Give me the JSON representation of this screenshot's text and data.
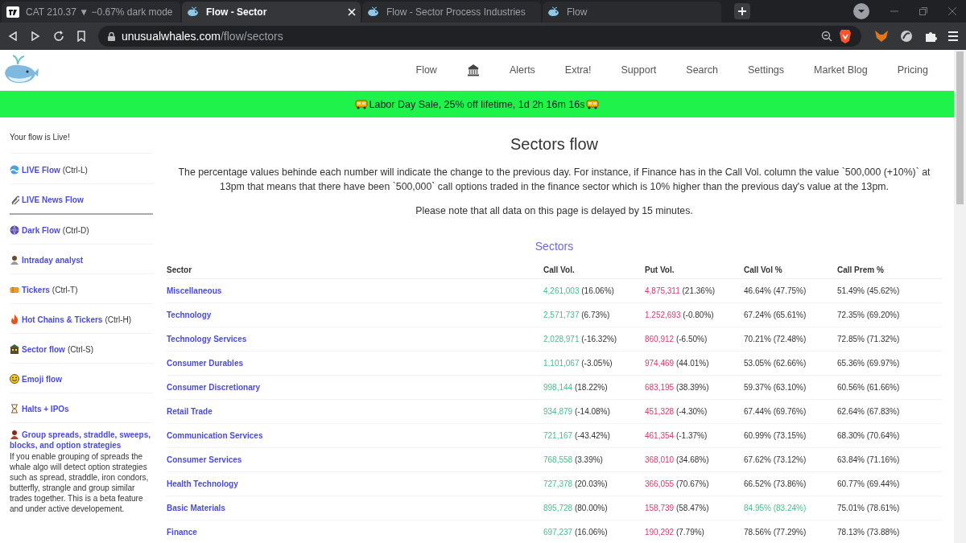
{
  "browser": {
    "tabs": [
      {
        "kind": "chart",
        "title": "CAT 210.37 ▼ −0.67% dark mode",
        "selected": false
      },
      {
        "kind": "site",
        "title": "Flow - Sector",
        "selected": true
      },
      {
        "kind": "site",
        "title": "Flow - Sector Process Industries",
        "selected": false
      },
      {
        "kind": "site",
        "title": "Flow",
        "selected": false
      }
    ],
    "address": {
      "domain": "unusualwhales.com",
      "path": "/flow/sectors"
    }
  },
  "header": {
    "nav": [
      {
        "kind": "link",
        "label": "Flow"
      },
      {
        "kind": "icon"
      },
      {
        "kind": "link",
        "label": "Alerts"
      },
      {
        "kind": "link",
        "label": "Extra!"
      },
      {
        "kind": "link",
        "label": "Support"
      },
      {
        "kind": "link",
        "label": "Search"
      },
      {
        "kind": "link",
        "label": "Settings"
      },
      {
        "kind": "link",
        "label": "Market Blog"
      },
      {
        "kind": "link",
        "label": "Pricing"
      }
    ]
  },
  "banner": {
    "text": "Labor Day Sale, 25% off lifetime, 1d 2h 16m 16s"
  },
  "sidebar": {
    "status": "Your flow is Live!",
    "items": [
      {
        "label": "LIVE Flow",
        "shortcut": "(Ctrl-L)",
        "divider_after": false
      },
      {
        "label": "LIVE News Flow",
        "divider_after": true
      },
      {
        "label": "Dark Flow",
        "shortcut": "(Ctrl-D)",
        "divider_after": false
      },
      {
        "label": "Intraday analyst",
        "divider_after": false
      },
      {
        "label": "Tickers",
        "shortcut": "(Ctrl-T)",
        "divider_after": false
      },
      {
        "label": "Hot Chains & Tickers",
        "shortcut": "(Ctrl-H)",
        "divider_after": false
      },
      {
        "label": "Sector flow",
        "shortcut": "(Ctrl-S)",
        "divider_after": false
      },
      {
        "label": "Emoji flow",
        "divider_after": false
      },
      {
        "label": "Halts + IPOs",
        "divider_after": false
      },
      {
        "label": "Group spreads, straddle, sweeps, blocks, and option strategies",
        "description": "If you enable grouping of spreads the whale algo will detect option strategies such as spread, straddle, iron condors, butterfly, strangle and group similar trades together. This is a beta feature and under active developement.",
        "divider_after": false
      }
    ]
  },
  "main": {
    "title": "Sectors flow",
    "intro": "The percentage values behinde each number will indicate the change to the previous day. For instance, if Finance has in the Call Vol. column the value `500,000 (+10%)` at 13pm that means that there have been `500,000` call options traded in the finance sector which is 10% higher than the previous day's value at the 13pm.",
    "note": "Please note that all data on this page is delayed by 15 minutes.",
    "section_title": "Sectors",
    "table": {
      "columns": [
        "Sector",
        "Call Vol.",
        "Put Vol.",
        "Call Vol %",
        "Call Prem %"
      ],
      "rows": [
        {
          "sector": "Miscellaneous",
          "call_vol": {
            "value": "4,261,003",
            "change": "(16.06%)"
          },
          "put_vol": {
            "value": "4,875,311",
            "change": "(21.36%)"
          },
          "call_vol_pct": "46.64% (47.75%)",
          "highlighted": false,
          "call_prem_pct": "51.49% (45.62%)"
        },
        {
          "sector": "Technology",
          "call_vol": {
            "value": "2,571,737",
            "change": "(6.73%)"
          },
          "put_vol": {
            "value": "1,252,693",
            "change": "(-0.80%)"
          },
          "call_vol_pct": "67.24% (65.61%)",
          "highlighted": false,
          "call_prem_pct": "72.35% (69.20%)"
        },
        {
          "sector": "Technology Services",
          "call_vol": {
            "value": "2,028,971",
            "change": "(-16.32%)"
          },
          "put_vol": {
            "value": "860,912",
            "change": "(-6.50%)"
          },
          "call_vol_pct": "70.21% (72.48%)",
          "highlighted": false,
          "call_prem_pct": "72.85% (71.32%)"
        },
        {
          "sector": "Consumer Durables",
          "call_vol": {
            "value": "1,101,067",
            "change": "(-3.05%)"
          },
          "put_vol": {
            "value": "974,469",
            "change": "(44.01%)"
          },
          "call_vol_pct": "53.05% (62.66%)",
          "highlighted": false,
          "call_prem_pct": "65.36% (69.97%)"
        },
        {
          "sector": "Consumer Discretionary",
          "call_vol": {
            "value": "998,144",
            "change": "(18.22%)"
          },
          "put_vol": {
            "value": "683,195",
            "change": "(38.39%)"
          },
          "call_vol_pct": "59.37% (63.10%)",
          "highlighted": false,
          "call_prem_pct": "60.56% (61.66%)"
        },
        {
          "sector": "Retail Trade",
          "call_vol": {
            "value": "934,879",
            "change": "(-14.08%)"
          },
          "put_vol": {
            "value": "451,328",
            "change": "(-4.30%)"
          },
          "call_vol_pct": "67.44% (69.76%)",
          "highlighted": false,
          "call_prem_pct": "62.64% (67.83%)"
        },
        {
          "sector": "Communication Services",
          "call_vol": {
            "value": "721,167",
            "change": "(-43.42%)"
          },
          "put_vol": {
            "value": "461,354",
            "change": "(-1.37%)"
          },
          "call_vol_pct": "60.99% (73.15%)",
          "highlighted": false,
          "call_prem_pct": "68.30% (70.64%)"
        },
        {
          "sector": "Consumer Services",
          "call_vol": {
            "value": "768,558",
            "change": "(3.39%)"
          },
          "put_vol": {
            "value": "368,010",
            "change": "(34.68%)"
          },
          "call_vol_pct": "67.62% (73.12%)",
          "highlighted": false,
          "call_prem_pct": "63.84% (71.16%)"
        },
        {
          "sector": "Health Technology",
          "call_vol": {
            "value": "727,378",
            "change": "(20.03%)"
          },
          "put_vol": {
            "value": "366,055",
            "change": "(70.67%)"
          },
          "call_vol_pct": "66.52% (73.86%)",
          "highlighted": false,
          "call_prem_pct": "60.77% (69.44%)"
        },
        {
          "sector": "Basic Materials",
          "call_vol": {
            "value": "895,728",
            "change": "(80.00%)"
          },
          "put_vol": {
            "value": "158,739",
            "change": "(58.47%)"
          },
          "call_vol_pct": "84.95% (83.24%)",
          "highlighted": true,
          "call_prem_pct": "75.01% (78.61%)"
        },
        {
          "sector": "Finance",
          "call_vol": {
            "value": "697,237",
            "change": "(16.06%)"
          },
          "put_vol": {
            "value": "190,292",
            "change": "(7.79%)"
          },
          "call_vol_pct": "78.56% (77.29%)",
          "highlighted": false,
          "call_prem_pct": "78.13% (73.88%)"
        }
      ]
    }
  }
}
